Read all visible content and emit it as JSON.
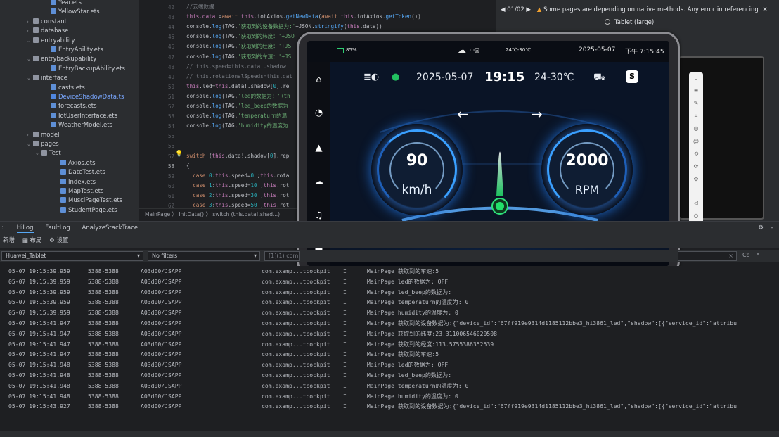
{
  "tree": [
    {
      "label": "Year.ets",
      "type": "ets",
      "indent": 72,
      "arrow": ""
    },
    {
      "label": "YellowStar.ets",
      "type": "ets",
      "indent": 72,
      "arrow": ""
    },
    {
      "label": "constant",
      "type": "folder",
      "indent": 50,
      "arrow": "›"
    },
    {
      "label": "database",
      "type": "folder",
      "indent": 50,
      "arrow": "›"
    },
    {
      "label": "entryability",
      "type": "folder",
      "indent": 50,
      "arrow": "⌄"
    },
    {
      "label": "EntryAbility.ets",
      "type": "ets",
      "indent": 72,
      "arrow": ""
    },
    {
      "label": "entrybackupability",
      "type": "folder",
      "indent": 50,
      "arrow": "⌄"
    },
    {
      "label": "EntryBackupAbility.ets",
      "type": "ets",
      "indent": 72,
      "arrow": ""
    },
    {
      "label": "interface",
      "type": "folder",
      "indent": 50,
      "arrow": "⌄"
    },
    {
      "label": "casts.ets",
      "type": "ets",
      "indent": 72,
      "arrow": ""
    },
    {
      "label": "DeviceShadowData.ts",
      "type": "ts",
      "indent": 72,
      "arrow": "",
      "selected": true
    },
    {
      "label": "forecasts.ets",
      "type": "ets",
      "indent": 72,
      "arrow": ""
    },
    {
      "label": "IotUserInterface.ets",
      "type": "ets",
      "indent": 72,
      "arrow": ""
    },
    {
      "label": "WeatherModel.ets",
      "type": "ets",
      "indent": 72,
      "arrow": ""
    },
    {
      "label": "model",
      "type": "folder",
      "indent": 50,
      "arrow": "›"
    },
    {
      "label": "pages",
      "type": "folder",
      "indent": 50,
      "arrow": "⌄"
    },
    {
      "label": "Test",
      "type": "folder",
      "indent": 62,
      "arrow": "⌄"
    },
    {
      "label": "Axios.ets",
      "type": "ets",
      "indent": 86,
      "arrow": ""
    },
    {
      "label": "DateTest.ets",
      "type": "ets",
      "indent": 86,
      "arrow": ""
    },
    {
      "label": "Index.ets",
      "type": "ets",
      "indent": 86,
      "arrow": ""
    },
    {
      "label": "MapTest.ets",
      "type": "ets",
      "indent": 86,
      "arrow": ""
    },
    {
      "label": "MusciPageTest.ets",
      "type": "ets",
      "indent": 86,
      "arrow": ""
    },
    {
      "label": "StudentPage.ets",
      "type": "ets",
      "indent": 86,
      "arrow": ""
    }
  ],
  "line_numbers": [
    "42",
    "43",
    "44",
    "45",
    "46",
    "47",
    "48",
    "49",
    "50",
    "51",
    "52",
    "53",
    "54",
    "55",
    "56",
    "57",
    "58",
    "59",
    "60",
    "61",
    "62"
  ],
  "code": [
    {
      "parts": [
        [
          "cm",
          "//云端数据"
        ]
      ]
    },
    {
      "parts": [
        [
          "pr",
          "this"
        ],
        [
          "",
          "."
        ],
        [
          "pr",
          "data"
        ],
        [
          "",
          " ="
        ],
        [
          "kw",
          "await "
        ],
        [
          "pr",
          "this"
        ],
        [
          "",
          ".iotAxios."
        ],
        [
          "fn",
          "getNewData"
        ],
        [
          "",
          "("
        ],
        [
          "kw",
          "await "
        ],
        [
          "pr",
          "this"
        ],
        [
          "",
          ".iotAxios."
        ],
        [
          "fn",
          "getToken"
        ],
        [
          "",
          "())"
        ]
      ]
    },
    {
      "parts": [
        [
          "",
          "console."
        ],
        [
          "fn",
          "log"
        ],
        [
          "",
          "(TAG,"
        ],
        [
          "str",
          "'获取到的设备数据为:'"
        ],
        [
          "",
          "+JSON."
        ],
        [
          "fn",
          "stringify"
        ],
        [
          "",
          "("
        ],
        [
          "pr",
          "this"
        ],
        [
          "",
          ".data))"
        ]
      ]
    },
    {
      "parts": [
        [
          "",
          "console."
        ],
        [
          "fn",
          "log"
        ],
        [
          "",
          "(TAG,"
        ],
        [
          "str",
          "'获取到的纬度：'+JSO"
        ]
      ]
    },
    {
      "parts": [
        [
          "",
          "console."
        ],
        [
          "fn",
          "log"
        ],
        [
          "",
          "(TAG,"
        ],
        [
          "str",
          "'获取到的经度：'+JS"
        ]
      ]
    },
    {
      "parts": [
        [
          "",
          "console."
        ],
        [
          "fn",
          "log"
        ],
        [
          "",
          "(TAG,"
        ],
        [
          "str",
          "'获取到的车速：'+JS"
        ]
      ]
    },
    {
      "parts": [
        [
          "cm",
          "// this.speed=this.data!.shadow"
        ]
      ]
    },
    {
      "parts": [
        [
          "cm",
          "// this.rotationalSpeeds=this.dat"
        ]
      ]
    },
    {
      "parts": [
        [
          "pr",
          "this"
        ],
        [
          "",
          ".led="
        ],
        [
          "pr",
          "this"
        ],
        [
          "",
          ".data!.shadow["
        ],
        [
          "num",
          "0"
        ],
        [
          "",
          "].re"
        ]
      ]
    },
    {
      "parts": [
        [
          "",
          "console."
        ],
        [
          "fn",
          "log"
        ],
        [
          "",
          "(TAG,"
        ],
        [
          "str",
          "'led的数据为：'+th"
        ]
      ]
    },
    {
      "parts": [
        [
          "",
          "console."
        ],
        [
          "fn",
          "log"
        ],
        [
          "",
          "(TAG,"
        ],
        [
          "str",
          "'led_beep的数据为"
        ]
      ]
    },
    {
      "parts": [
        [
          "",
          "console."
        ],
        [
          "fn",
          "log"
        ],
        [
          "",
          "(TAG,"
        ],
        [
          "str",
          "'temperaturn的温"
        ]
      ]
    },
    {
      "parts": [
        [
          "",
          "console."
        ],
        [
          "fn",
          "log"
        ],
        [
          "",
          "(TAG,"
        ],
        [
          "str",
          "'humidity的温度为"
        ]
      ]
    },
    {
      "parts": [
        [
          "",
          ""
        ]
      ]
    },
    {
      "parts": [
        [
          "",
          ""
        ]
      ]
    },
    {
      "parts": [
        [
          "kw",
          "switch "
        ],
        [
          "",
          "("
        ],
        [
          "pr",
          "this"
        ],
        [
          "",
          ".data!.shadow["
        ],
        [
          "num",
          "0"
        ],
        [
          "",
          "].rep"
        ]
      ]
    },
    {
      "parts": [
        [
          "",
          "{"
        ]
      ]
    },
    {
      "parts": [
        [
          "kw",
          "  case "
        ],
        [
          "num",
          "0"
        ],
        [
          "",
          ":"
        ],
        [
          "pr",
          "this"
        ],
        [
          "",
          ".speed="
        ],
        [
          "num",
          "0"
        ],
        [
          "",
          " ;"
        ],
        [
          "pr",
          "this"
        ],
        [
          "",
          ".rota"
        ]
      ]
    },
    {
      "parts": [
        [
          "kw",
          "  case "
        ],
        [
          "num",
          "1"
        ],
        [
          "",
          ":"
        ],
        [
          "pr",
          "this"
        ],
        [
          "",
          ".speed="
        ],
        [
          "num",
          "10"
        ],
        [
          "",
          " ;"
        ],
        [
          "pr",
          "this"
        ],
        [
          "",
          ".rot"
        ]
      ]
    },
    {
      "parts": [
        [
          "kw",
          "  case "
        ],
        [
          "num",
          "2"
        ],
        [
          "",
          ":"
        ],
        [
          "pr",
          "this"
        ],
        [
          "",
          ".speed="
        ],
        [
          "num",
          "30"
        ],
        [
          "",
          " ;"
        ],
        [
          "pr",
          "this"
        ],
        [
          "",
          ".rot"
        ]
      ]
    },
    {
      "parts": [
        [
          "kw",
          "  case "
        ],
        [
          "num",
          "3"
        ],
        [
          "",
          ":"
        ],
        [
          "pr",
          "this"
        ],
        [
          "",
          ".speed="
        ],
        [
          "num",
          "50"
        ],
        [
          "",
          " ;"
        ],
        [
          "pr",
          "this"
        ],
        [
          "",
          ".rot"
        ]
      ]
    }
  ],
  "breadcrumb": "MainPage 〉 InitData() 〉 switch (this.data!.shad...)",
  "previewer": {
    "page_indicator": "◀ 01/02 ▶",
    "warning": "Some pages are depending on native methods. Any error in referencing",
    "close": "✕",
    "device": "Tablet (large)"
  },
  "tablet": {
    "battery": "85%",
    "signal": "中国",
    "weather_small": "24℃-30℃",
    "date_small": "2025-05-07",
    "time_small": "下午 7:15:45",
    "date": "2025-05-07",
    "time": "19:15",
    "temp": "24-30℃",
    "speed": "90",
    "speed_unit": "km/h",
    "rpm": "2000",
    "rpm_unit": "RPM"
  },
  "log": {
    "tabs": [
      "HiLog",
      "FaultLog",
      "AnalyzeStackTrace"
    ],
    "toolbar": [
      "新增",
      "布局",
      "设置"
    ],
    "device": "Huawei_Tablet",
    "filter": "No filters",
    "search_placeholder": "[1](1) com",
    "case_label": "Cc",
    "rows": [
      [
        "05-07 19:15:39.959",
        "5388-5388",
        "A03d00/JSAPP",
        "com.examp...tcockpit",
        "I",
        "MainPage 获取到的车速:5"
      ],
      [
        "05-07 19:15:39.959",
        "5388-5388",
        "A03d00/JSAPP",
        "com.examp...tcockpit",
        "I",
        "MainPage led的数据为: OFF"
      ],
      [
        "05-07 19:15:39.959",
        "5388-5388",
        "A03d00/JSAPP",
        "com.examp...tcockpit",
        "I",
        "MainPage led_beep的数据为:"
      ],
      [
        "05-07 19:15:39.959",
        "5388-5388",
        "A03d00/JSAPP",
        "com.examp...tcockpit",
        "I",
        "MainPage temperaturn的温度为: 0"
      ],
      [
        "05-07 19:15:39.959",
        "5388-5388",
        "A03d00/JSAPP",
        "com.examp...tcockpit",
        "I",
        "MainPage humidity的温度为: 0"
      ],
      [
        "05-07 19:15:41.947",
        "5388-5388",
        "A03d00/JSAPP",
        "com.examp...tcockpit",
        "I",
        "MainPage 获取到的设备数据为:{\"device_id\":\"67ff919e9314d1185112bbe3_hi3861_led\",\"shadow\":[{\"service_id\":\"attribu"
      ],
      [
        "05-07 19:15:41.947",
        "5388-5388",
        "A03d00/JSAPP",
        "com.examp...tcockpit",
        "I",
        "MainPage 获取到的纬度:23.311006546020508"
      ],
      [
        "05-07 19:15:41.947",
        "5388-5388",
        "A03d00/JSAPP",
        "com.examp...tcockpit",
        "I",
        "MainPage 获取到的经度:113.5755386352539"
      ],
      [
        "05-07 19:15:41.947",
        "5388-5388",
        "A03d00/JSAPP",
        "com.examp...tcockpit",
        "I",
        "MainPage 获取到的车速:5"
      ],
      [
        "05-07 19:15:41.948",
        "5388-5388",
        "A03d00/JSAPP",
        "com.examp...tcockpit",
        "I",
        "MainPage led的数据为: OFF"
      ],
      [
        "05-07 19:15:41.948",
        "5388-5388",
        "A03d00/JSAPP",
        "com.examp...tcockpit",
        "I",
        "MainPage led_beep的数据为:"
      ],
      [
        "05-07 19:15:41.948",
        "5388-5388",
        "A03d00/JSAPP",
        "com.examp...tcockpit",
        "I",
        "MainPage temperaturn的温度为: 0"
      ],
      [
        "05-07 19:15:41.948",
        "5388-5388",
        "A03d00/JSAPP",
        "com.examp...tcockpit",
        "I",
        "MainPage humidity的温度为: 0"
      ],
      [
        "05-07 19:15:43.927",
        "5388-5388",
        "A03d00/JSAPP",
        "com.examp...tcockpit",
        "I",
        "MainPage 获取到的设备数据为:{\"device_id\":\"67ff919e9314d1185112bbe3_hi3861_led\",\"shadow\":[{\"service_id\":\"attribu"
      ]
    ]
  },
  "colors": {
    "accent": "#56a8f5",
    "gauge_glow": "#2f8bff",
    "led_green": "#1fd05a",
    "warning": "#f0a030"
  }
}
